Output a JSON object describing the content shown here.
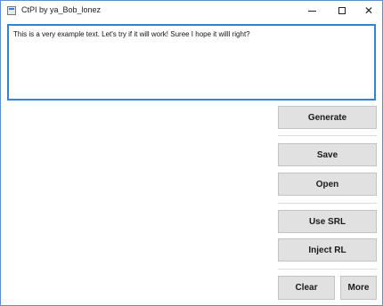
{
  "window": {
    "title": "CtPI by ya_Bob_lonez",
    "minimize_symbol": "",
    "maximize_symbol": "",
    "close_symbol": "✕"
  },
  "editor": {
    "text": "This is a very example text. Let's try if it will work! Suree I hope it willl right?"
  },
  "status": {
    "text": ""
  },
  "buttons": {
    "generate": "Generate",
    "save": "Save",
    "open": "Open",
    "use_srl": "Use SRL",
    "inject_rl": "Inject RL",
    "clear": "Clear",
    "more": "More"
  },
  "colors": {
    "accent": "#2f84d6",
    "button_bg": "#e1e1e1",
    "button_border": "#c3c3c3"
  }
}
